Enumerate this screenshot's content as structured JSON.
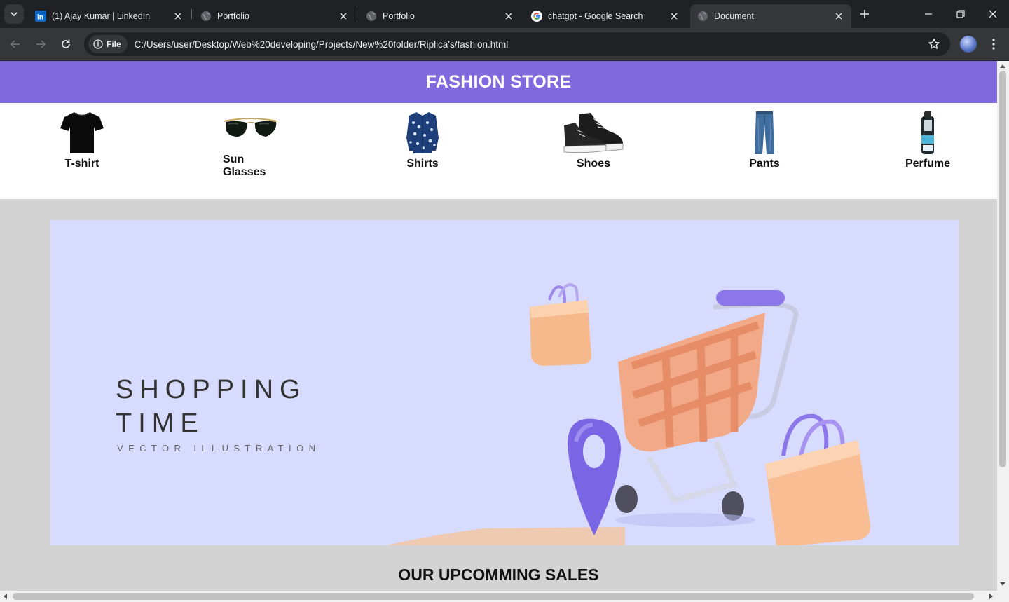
{
  "browser": {
    "tabs": [
      {
        "title": "(1) Ajay Kumar | LinkedIn",
        "icon": "linkedin-icon",
        "active": false
      },
      {
        "title": "Portfolio",
        "icon": "globe-icon",
        "active": false
      },
      {
        "title": "Portfolio",
        "icon": "globe-icon",
        "active": false
      },
      {
        "title": "chatgpt - Google Search",
        "icon": "google-icon",
        "active": false
      },
      {
        "title": "Document",
        "icon": "globe-icon",
        "active": true
      }
    ],
    "address": {
      "scheme_chip": "File",
      "url": "C:/Users/user/Desktop/Web%20developing/Projects/New%20folder/Riplica's/fashion.html"
    }
  },
  "page": {
    "header": {
      "title": "FASHION STORE",
      "background": "#8069dd"
    },
    "categories": [
      {
        "label": "T-shirt",
        "icon": "tshirt-icon"
      },
      {
        "label": "Sun Glasses",
        "icon": "sunglasses-icon"
      },
      {
        "label": "Shirts",
        "icon": "shirt-icon"
      },
      {
        "label": "Shoes",
        "icon": "shoes-icon"
      },
      {
        "label": "Pants",
        "icon": "pants-icon"
      },
      {
        "label": "Perfume",
        "icon": "perfume-icon"
      }
    ],
    "banner": {
      "headline_line1": "SHOPPING",
      "headline_line2": "TIME",
      "subline": "VECTOR ILLUSTRATION",
      "background": "#d7dbfd"
    },
    "sales_heading": "OUR UPCOMMING SALES"
  }
}
